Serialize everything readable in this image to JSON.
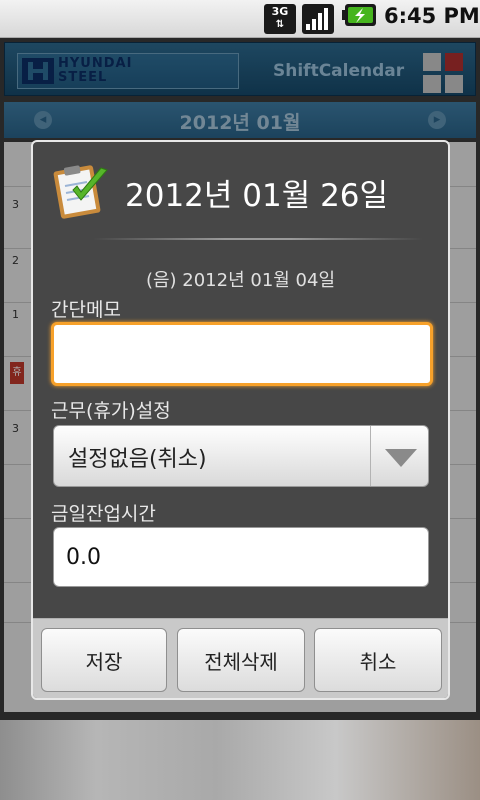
{
  "status_bar": {
    "network": "3G",
    "time": "6:45 PM"
  },
  "app": {
    "logo_line1": "HYUNDAI",
    "logo_line2": "STEEL",
    "title": "ShiftCalendar",
    "month": "2012년 01월",
    "side_numbers": [
      "3",
      "2",
      "1",
      "3"
    ],
    "side_badge": "휴"
  },
  "dialog": {
    "title": "2012년 01월 26일",
    "lunar_date": "(음) 2012년 01월 04일",
    "memo_label": "간단메모",
    "memo_value": "",
    "shift_label": "근무(휴가)설정",
    "shift_value": "설정없음(취소)",
    "overtime_label": "금일잔업시간",
    "overtime_value": "0.0",
    "buttons": {
      "save": "저장",
      "delete_all": "전체삭제",
      "cancel": "취소"
    }
  },
  "colors": {
    "accent_focus": "#f7a12a",
    "header_blue": "#2d6a8f",
    "dialog_bg": "#474747"
  }
}
